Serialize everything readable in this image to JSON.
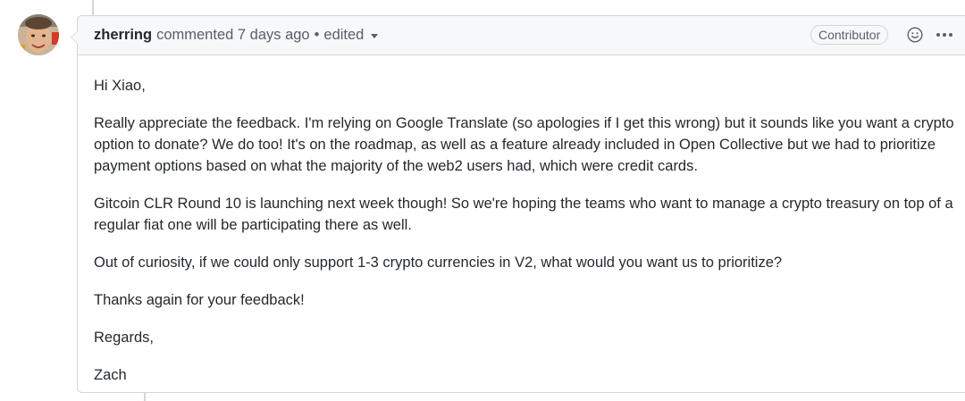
{
  "comment": {
    "author": "zherring",
    "action": "commented 7 days ago",
    "separator": "•",
    "edited_label": "edited",
    "badge": "Contributor",
    "body": {
      "greeting": "Hi Xiao,",
      "p1": "Really appreciate the feedback. I'm relying on Google Translate (so apologies if I get this wrong) but it sounds like you want a crypto option to donate? We do too! It's on the roadmap, as well as a feature already included in Open Collective but we had to prioritize payment options based on what the majority of the web2 users had, which were credit cards.",
      "p2": "Gitcoin CLR Round 10 is launching next week though! So we're hoping the teams who want to manage a crypto treasury on top of a regular fiat one will be participating there as well.",
      "p3": "Out of curiosity, if we could only support 1-3 crypto currencies in V2, what would you want us to prioritize?",
      "p4": "Thanks again for your feedback!",
      "closing": "Regards,",
      "signature": "Zach"
    }
  },
  "icons": {
    "avatar": "avatar",
    "reaction": "smiley-icon",
    "more": "kebab-horizontal-icon",
    "edited_caret": "triangle-down-icon"
  },
  "colors": {
    "header_bg": "#f6f8fa",
    "border": "#d0d7de",
    "muted_text": "#57606a",
    "text": "#24292f"
  }
}
